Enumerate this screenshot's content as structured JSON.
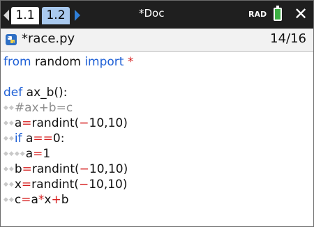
{
  "tabs": [
    {
      "label": "1.1",
      "active": true
    },
    {
      "label": "1.2",
      "active": false
    }
  ],
  "document_title": "*Doc",
  "angle_mode": "RAD",
  "battery_level": 1.0,
  "editor": {
    "file_name": "*race.py",
    "line_position": "14/16"
  },
  "code_lines": [
    {
      "indent": 0,
      "tokens": [
        {
          "t": "kw",
          "v": "from"
        },
        {
          "t": "tx",
          "v": " random "
        },
        {
          "t": "kw",
          "v": "import"
        },
        {
          "t": "tx",
          "v": " "
        },
        {
          "t": "op",
          "v": "*"
        }
      ]
    },
    {
      "indent": 0,
      "tokens": []
    },
    {
      "indent": 0,
      "tokens": [
        {
          "t": "kw",
          "v": "def"
        },
        {
          "t": "tx",
          "v": " ax_b():"
        }
      ]
    },
    {
      "indent": 1,
      "tokens": [
        {
          "t": "cm",
          "v": "#ax+b=c"
        }
      ]
    },
    {
      "indent": 1,
      "tokens": [
        {
          "t": "tx",
          "v": "a"
        },
        {
          "t": "op",
          "v": "="
        },
        {
          "t": "tx",
          "v": "randint("
        },
        {
          "t": "op",
          "v": "−"
        },
        {
          "t": "tx",
          "v": "10,10)"
        }
      ]
    },
    {
      "indent": 1,
      "tokens": [
        {
          "t": "kw",
          "v": "if"
        },
        {
          "t": "tx",
          "v": " a"
        },
        {
          "t": "op",
          "v": "=="
        },
        {
          "t": "tx",
          "v": "0:"
        }
      ]
    },
    {
      "indent": 2,
      "tokens": [
        {
          "t": "tx",
          "v": "a"
        },
        {
          "t": "op",
          "v": "="
        },
        {
          "t": "tx",
          "v": "1"
        }
      ]
    },
    {
      "indent": 1,
      "tokens": [
        {
          "t": "tx",
          "v": "b"
        },
        {
          "t": "op",
          "v": "="
        },
        {
          "t": "tx",
          "v": "randint("
        },
        {
          "t": "op",
          "v": "−"
        },
        {
          "t": "tx",
          "v": "10,10)"
        }
      ]
    },
    {
      "indent": 1,
      "tokens": [
        {
          "t": "tx",
          "v": "x"
        },
        {
          "t": "op",
          "v": "="
        },
        {
          "t": "tx",
          "v": "randint("
        },
        {
          "t": "op",
          "v": "−"
        },
        {
          "t": "tx",
          "v": "10,10)"
        }
      ]
    },
    {
      "indent": 1,
      "tokens": [
        {
          "t": "tx",
          "v": "c"
        },
        {
          "t": "op",
          "v": "="
        },
        {
          "t": "tx",
          "v": "a"
        },
        {
          "t": "op",
          "v": "*"
        },
        {
          "t": "tx",
          "v": "x"
        },
        {
          "t": "op",
          "v": "+"
        },
        {
          "t": "tx",
          "v": "b"
        }
      ]
    }
  ],
  "colors": {
    "keyword": "#2061d6",
    "operator": "#d61f1f",
    "comment": "#8e8e8e",
    "topbar": "#1f1f1f",
    "battery": "#3cb043"
  },
  "icons": {
    "nav_left": "triangle-left-icon",
    "nav_right": "triangle-right-icon",
    "battery": "battery-icon",
    "close": "close-icon",
    "file": "python-file-icon"
  }
}
